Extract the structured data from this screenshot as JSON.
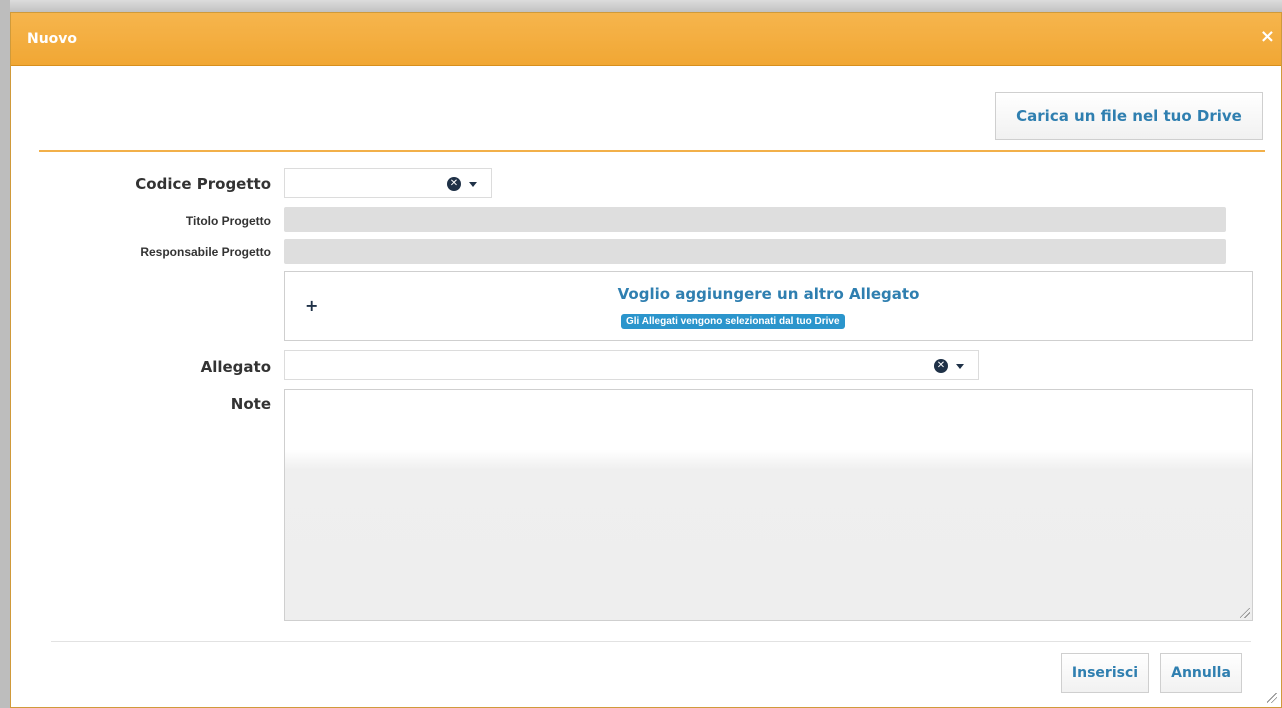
{
  "dialog": {
    "title": "Nuovo",
    "close_glyph": "×",
    "upload_button": "Carica un file nel tuo Drive"
  },
  "form": {
    "codice_progetto": {
      "label": "Codice Progetto",
      "value": ""
    },
    "titolo_progetto": {
      "label": "Titolo Progetto",
      "value": ""
    },
    "responsabile_progetto": {
      "label": "Responsabile Progetto",
      "value": ""
    },
    "attachment_add": {
      "plus": "+",
      "title": "Voglio aggiungere un altro Allegato",
      "badge": "Gli Allegati vengono selezionati dal tuo Drive"
    },
    "allegato": {
      "label": "Allegato",
      "value": ""
    },
    "note": {
      "label": "Note",
      "value": ""
    }
  },
  "footer": {
    "insert_button": "Inserisci",
    "cancel_button": "Annulla"
  },
  "colors": {
    "title_bar": "#f2ab3c",
    "accent_text": "#2f7fb0",
    "badge": "#2b95cc",
    "icon_dark": "#1f3147"
  },
  "icons": {
    "close": "close-icon",
    "clear": "clear-icon",
    "dropdown": "chevron-down-icon",
    "add": "plus-icon",
    "resize": "resize-grip-icon"
  }
}
